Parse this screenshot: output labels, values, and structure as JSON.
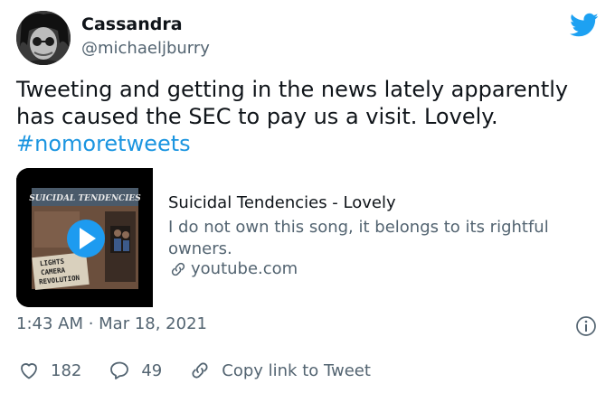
{
  "tweet": {
    "author_name": "Cassandra",
    "author_handle": "@michaeljburry",
    "text": "Tweeting and getting in the news lately apparently has caused the SEC to pay us a visit. Lovely.",
    "hashtag": "#nomoretweets",
    "timestamp": "1:43 AM · Mar 18, 2021",
    "brand_color": "#1da1f2",
    "link_color": "#1b95e0"
  },
  "card": {
    "title": "Suicidal Tendencies - Lovely",
    "description": "I do not own this song, it belongs to its rightful owners.",
    "domain": "youtube.com",
    "thumbnail_text": {
      "band": "SUICIDAL TENDENCIES",
      "sign_line_1": "LIGHTS",
      "sign_line_2": "CAMERA",
      "sign_line_3": "REVOLUTION"
    }
  },
  "actions": {
    "likes_count": "182",
    "replies_count": "49",
    "copy_link_label": "Copy link to Tweet"
  },
  "icons": {
    "brand": "twitter-bird-icon",
    "info": "info-icon",
    "like": "heart-icon",
    "reply": "reply-icon",
    "link": "link-icon",
    "play": "play-icon"
  }
}
